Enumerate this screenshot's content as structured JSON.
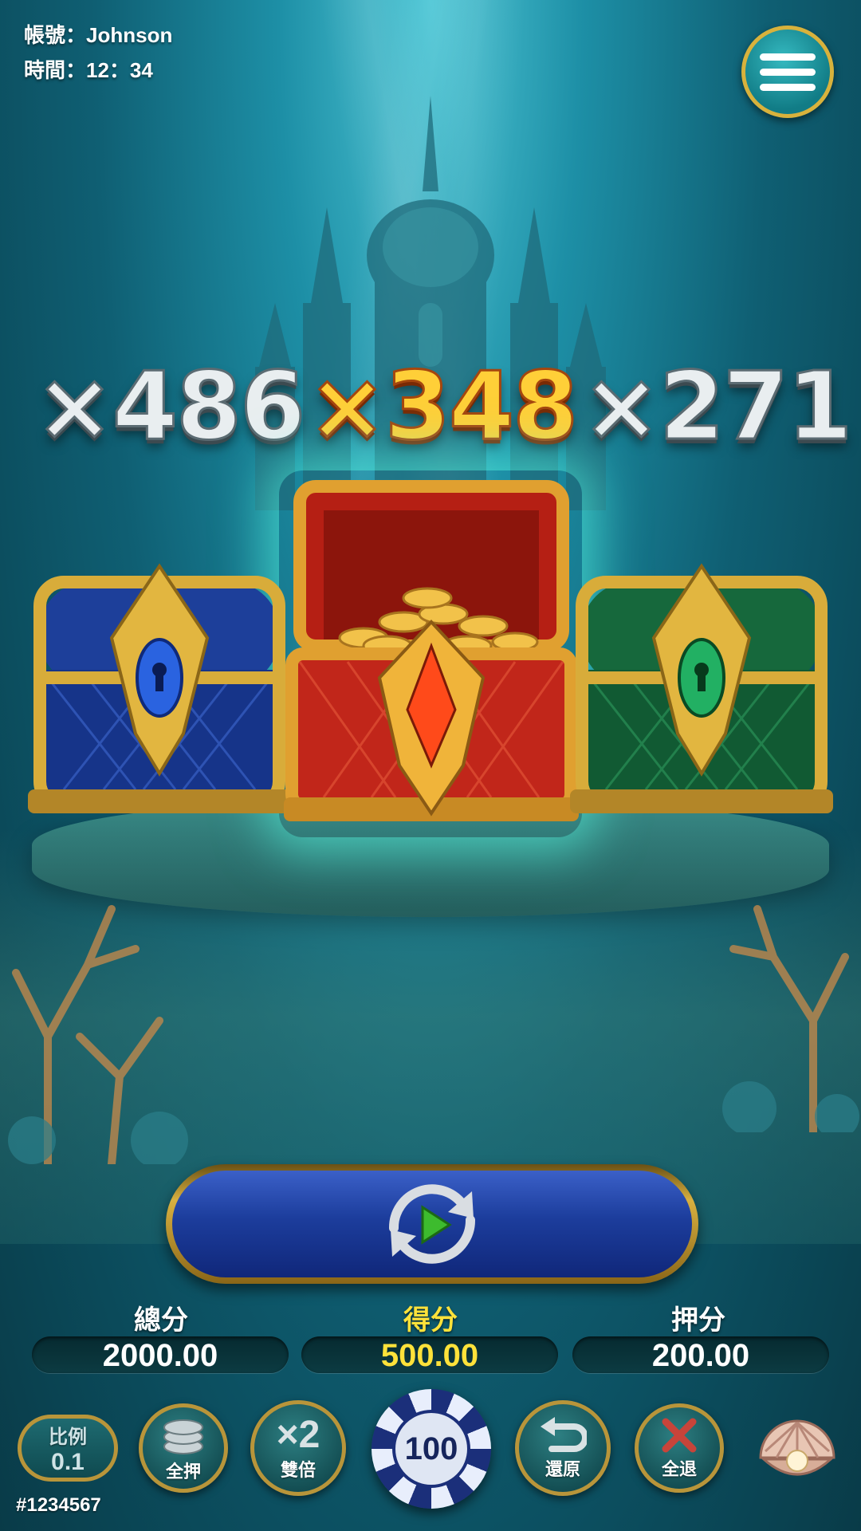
{
  "hud": {
    "account_label": "帳號：Johnson",
    "time_label": "時間：12：34"
  },
  "multipliers": {
    "left": "×486",
    "center": "×348",
    "right": "×271"
  },
  "chests": [
    {
      "color": "blue",
      "state": "closed"
    },
    {
      "color": "red",
      "state": "open-with-gold"
    },
    {
      "color": "green",
      "state": "closed"
    }
  ],
  "scores": {
    "total_label": "總分",
    "total_value": "2000.00",
    "win_label": "得分",
    "win_value": "500.00",
    "bet_label": "押分",
    "bet_value": "200.00"
  },
  "controls": {
    "ratio_label": "比例",
    "ratio_value": "0.1",
    "all_in_label": "全押",
    "double_symbol": "×2",
    "double_label": "雙倍",
    "chip_value": "100",
    "undo_label": "還原",
    "clear_label": "全退"
  },
  "footer": {
    "id_text": "#1234567"
  },
  "colors": {
    "gold": "#ffcf38",
    "win_yellow": "#ffe23a",
    "accent_teal": "#1d8fa6"
  }
}
